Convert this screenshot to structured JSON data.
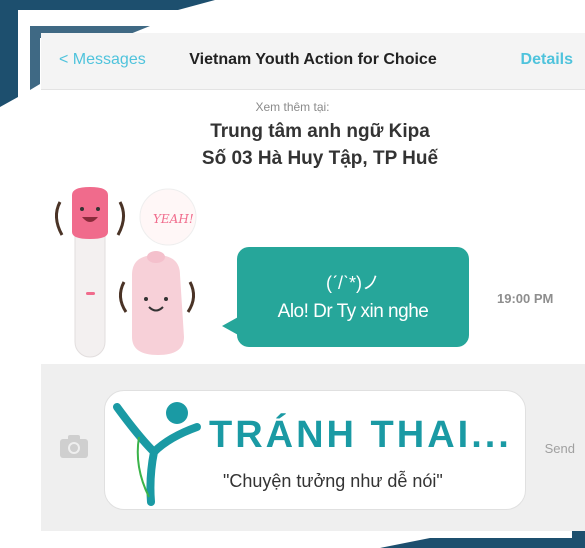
{
  "nav": {
    "back_label": "< Messages",
    "title": "Vietnam Youth Action for Choice",
    "details_label": "Details"
  },
  "header": {
    "note": "Xem thêm tại:",
    "address_line1": "Trung tâm anh ngữ Kipa",
    "address_line2": "Số 03 Hà Huy Tập, TP Huế"
  },
  "sticker": {
    "text": "YEAH!"
  },
  "message": {
    "kaomoji": "(ˊ/ˋ*)ノ",
    "text": "Alo! Dr Ty xin nghe",
    "time": "19:00 PM"
  },
  "input": {
    "send_label": "Send",
    "logo_title": "TRÁNH THAI...",
    "logo_slogan": "\"Chuyện tưởng như dễ nói\""
  },
  "colors": {
    "accent": "#4fc3dc",
    "bubble": "#26a69a",
    "brand_teal": "#1a9aa4",
    "frame_navy": "#1d4f6e"
  },
  "icons": [
    "camera-icon",
    "logo-figure-icon"
  ]
}
